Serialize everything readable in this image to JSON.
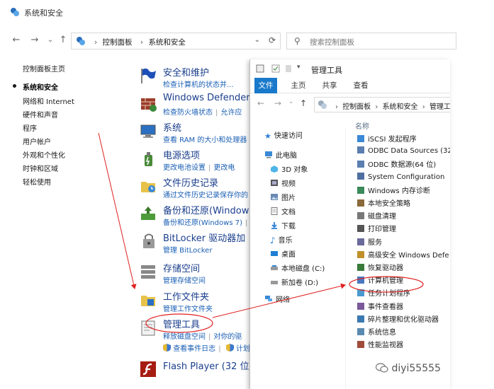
{
  "control_panel": {
    "title": "系统和安全",
    "breadcrumbs": [
      "控制面板",
      "系统和安全"
    ],
    "search_placeholder": "搜索控制面板",
    "sidebar": [
      {
        "label": "控制面板主页",
        "current": false
      },
      {
        "label": "系统和安全",
        "current": true
      },
      {
        "label": "网络和 Internet",
        "current": false
      },
      {
        "label": "硬件和声音",
        "current": false
      },
      {
        "label": "程序",
        "current": false
      },
      {
        "label": "用户帐户",
        "current": false
      },
      {
        "label": "外观和个性化",
        "current": false
      },
      {
        "label": "时钟和区域",
        "current": false
      },
      {
        "label": "轻松使用",
        "current": false
      }
    ],
    "categories": [
      {
        "title": "安全和维护",
        "links": [
          "检查计算机的状态并..."
        ],
        "icon": "flag-icon"
      },
      {
        "title": "Windows Defender",
        "links": [
          "检查防火墙状态",
          "允许应"
        ],
        "icon": "firewall-icon"
      },
      {
        "title": "系统",
        "links": [
          "查看 RAM 的大小和处理器"
        ],
        "icon": "computer-icon"
      },
      {
        "title": "电源选项",
        "links": [
          "更改电池设置",
          "更改电"
        ],
        "icon": "power-icon"
      },
      {
        "title": "文件历史记录",
        "links": [
          "通过文件历史记录保存你的"
        ],
        "icon": "file-history-icon"
      },
      {
        "title": "备份和还原(Window",
        "links": [
          "备份和还原(Windows 7)",
          "从"
        ],
        "icon": "backup-icon"
      },
      {
        "title": "BitLocker 驱动器加",
        "links": [
          "管理 BitLocker"
        ],
        "icon": "bitlocker-icon"
      },
      {
        "title": "存储空间",
        "links": [
          "管理存储空间"
        ],
        "icon": "storage-icon"
      },
      {
        "title": "工作文件夹",
        "links": [
          "管理工作文件夹"
        ],
        "icon": "work-folders-icon"
      },
      {
        "title": "管理工具",
        "links": [
          "释放磁盘空间",
          "对你的驱"
        ],
        "links2": [
          "查看事件日志",
          "计划"
        ],
        "icon": "admin-tools-icon"
      },
      {
        "title": "Flash Player (32 位)",
        "links": [],
        "icon": "flash-icon"
      }
    ]
  },
  "explorer": {
    "title": "管理工具",
    "ribbon_tabs": [
      "文件",
      "主页",
      "共享",
      "查看"
    ],
    "breadcrumbs": [
      "控制面板",
      "系统和安全",
      "管理工"
    ],
    "nav_tree": [
      {
        "label": "快速访问",
        "icon": "star-icon"
      },
      {
        "label": "此电脑",
        "icon": "pc-icon"
      },
      {
        "label": "3D 对象",
        "icon": "3d-objects-icon"
      },
      {
        "label": "视频",
        "icon": "video-icon"
      },
      {
        "label": "图片",
        "icon": "pictures-icon"
      },
      {
        "label": "文档",
        "icon": "documents-icon"
      },
      {
        "label": "下载",
        "icon": "download-icon"
      },
      {
        "label": "音乐",
        "icon": "music-icon"
      },
      {
        "label": "桌面",
        "icon": "desktop-icon"
      },
      {
        "label": "本地磁盘 (C:)",
        "icon": "disk-icon"
      },
      {
        "label": "新加卷 (D:)",
        "icon": "drive-icon"
      },
      {
        "label": "网络",
        "icon": "network-icon"
      }
    ],
    "column_header": "名称",
    "tools": [
      "iSCSI 发起程序",
      "ODBC Data Sources (32-",
      "ODBC 数据源(64 位)",
      "System Configuration",
      "Windows 内存诊断",
      "本地安全策略",
      "磁盘清理",
      "打印管理",
      "服务",
      "高级安全 Windows Defe",
      "恢复驱动器",
      "计算机管理",
      "任务计划程序",
      "事件查看器",
      "碎片整理和优化驱动器",
      "系统信息",
      "性能监视器"
    ]
  },
  "watermark": "diyi55555",
  "colors": {
    "link": "#1a5fb4",
    "title_link": "#1a3e8c",
    "ribbon_file": "#1979ca",
    "annotation": "#e02020"
  }
}
